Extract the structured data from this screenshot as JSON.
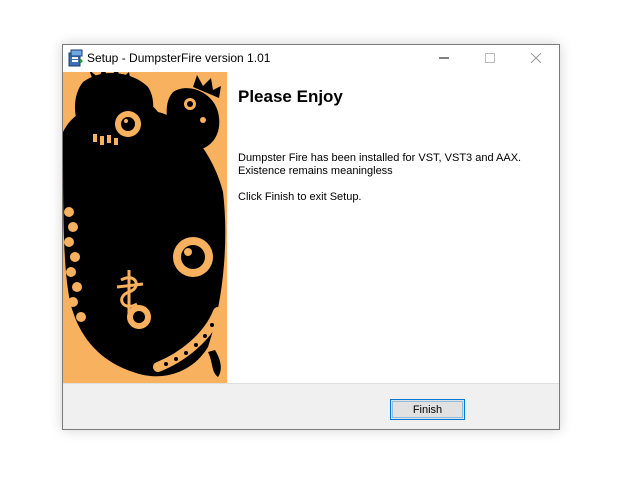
{
  "window": {
    "title": "Setup - DumpsterFire version 1.01",
    "app_icon": "installer-box-icon",
    "controls": {
      "minimize_icon": "minimize-icon",
      "maximize_icon": "maximize-icon",
      "close_icon": "close-icon"
    }
  },
  "side_panel": {
    "image": "dumpster-fire-creature-artwork",
    "background_color": "#f8b25f",
    "ink_color": "#000000"
  },
  "content": {
    "heading": "Please Enjoy",
    "line1": "Dumpster Fire has been installed for VST, VST3 and AAX.",
    "line2": "Existence remains meaningless",
    "line3": "Click Finish to exit Setup."
  },
  "footer": {
    "finish_label": "Finish",
    "accent_color": "#0078d7"
  }
}
